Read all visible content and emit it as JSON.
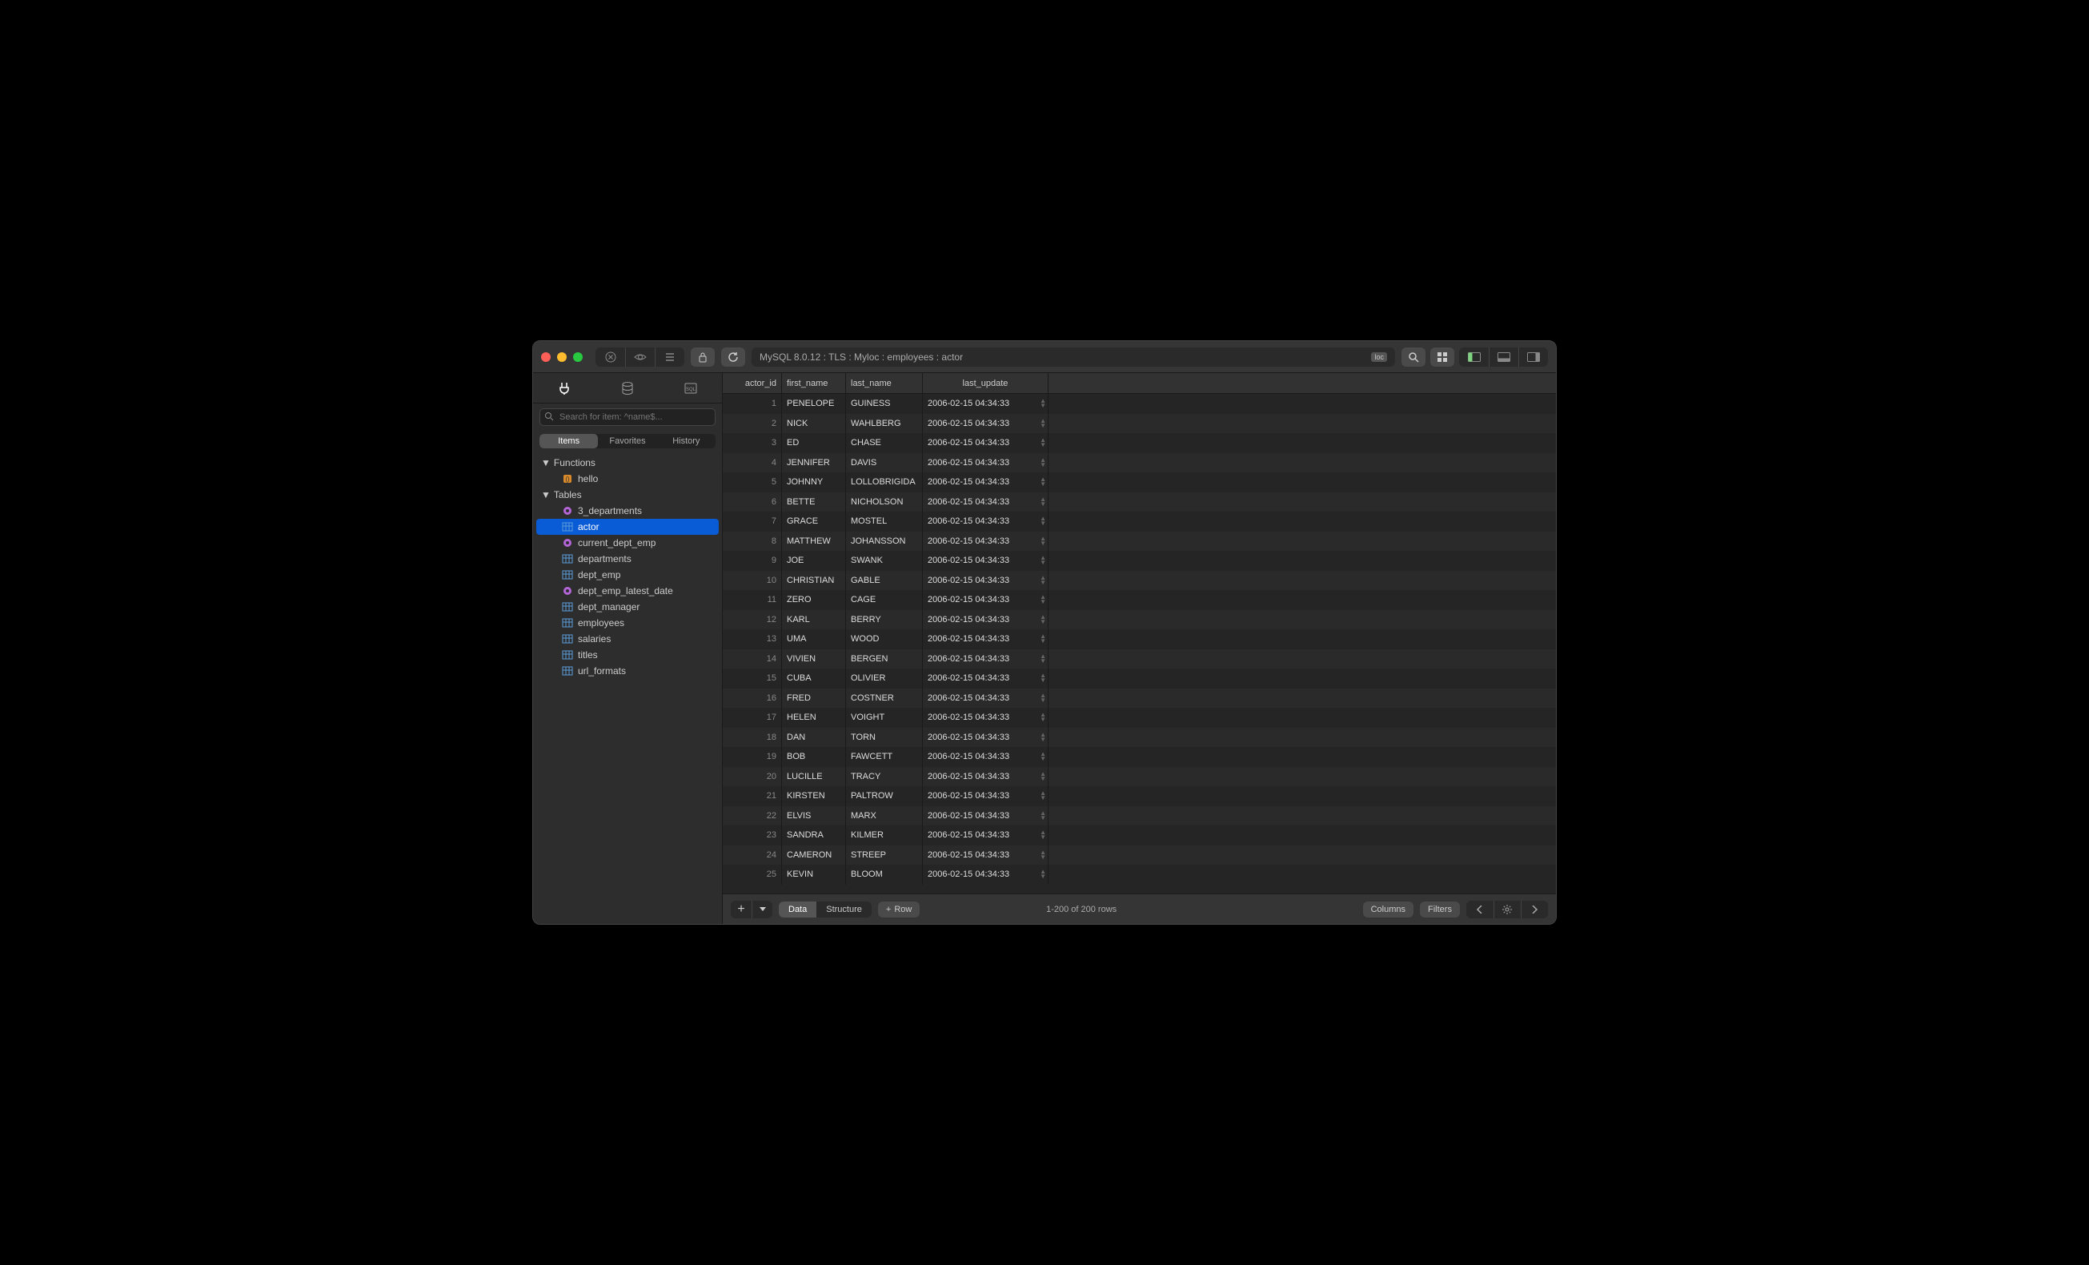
{
  "breadcrumb": "MySQL 8.0.12 : TLS : Myloc : employees : actor",
  "breadcrumb_badge": "loc",
  "search": {
    "placeholder": "Search for item: ^name$..."
  },
  "sidebar_filter": {
    "items": "Items",
    "favorites": "Favorites",
    "history": "History"
  },
  "tree": {
    "functions_label": "Functions",
    "functions": [
      {
        "name": "hello",
        "kind": "func"
      }
    ],
    "tables_label": "Tables",
    "tables": [
      {
        "name": "3_departments",
        "kind": "view"
      },
      {
        "name": "actor",
        "kind": "table",
        "selected": true
      },
      {
        "name": "current_dept_emp",
        "kind": "view"
      },
      {
        "name": "departments",
        "kind": "table"
      },
      {
        "name": "dept_emp",
        "kind": "table"
      },
      {
        "name": "dept_emp_latest_date",
        "kind": "view"
      },
      {
        "name": "dept_manager",
        "kind": "table"
      },
      {
        "name": "employees",
        "kind": "table"
      },
      {
        "name": "salaries",
        "kind": "table"
      },
      {
        "name": "titles",
        "kind": "table"
      },
      {
        "name": "url_formats",
        "kind": "table"
      }
    ]
  },
  "columns": {
    "id": "actor_id",
    "fn": "first_name",
    "ln": "last_name",
    "lu": "last_update"
  },
  "rows": [
    {
      "id": "1",
      "fn": "PENELOPE",
      "ln": "GUINESS",
      "lu": "2006-02-15 04:34:33"
    },
    {
      "id": "2",
      "fn": "NICK",
      "ln": "WAHLBERG",
      "lu": "2006-02-15 04:34:33"
    },
    {
      "id": "3",
      "fn": "ED",
      "ln": "CHASE",
      "lu": "2006-02-15 04:34:33"
    },
    {
      "id": "4",
      "fn": "JENNIFER",
      "ln": "DAVIS",
      "lu": "2006-02-15 04:34:33"
    },
    {
      "id": "5",
      "fn": "JOHNNY",
      "ln": "LOLLOBRIGIDA",
      "lu": "2006-02-15 04:34:33"
    },
    {
      "id": "6",
      "fn": "BETTE",
      "ln": "NICHOLSON",
      "lu": "2006-02-15 04:34:33"
    },
    {
      "id": "7",
      "fn": "GRACE",
      "ln": "MOSTEL",
      "lu": "2006-02-15 04:34:33"
    },
    {
      "id": "8",
      "fn": "MATTHEW",
      "ln": "JOHANSSON",
      "lu": "2006-02-15 04:34:33"
    },
    {
      "id": "9",
      "fn": "JOE",
      "ln": "SWANK",
      "lu": "2006-02-15 04:34:33"
    },
    {
      "id": "10",
      "fn": "CHRISTIAN",
      "ln": "GABLE",
      "lu": "2006-02-15 04:34:33"
    },
    {
      "id": "11",
      "fn": "ZERO",
      "ln": "CAGE",
      "lu": "2006-02-15 04:34:33"
    },
    {
      "id": "12",
      "fn": "KARL",
      "ln": "BERRY",
      "lu": "2006-02-15 04:34:33"
    },
    {
      "id": "13",
      "fn": "UMA",
      "ln": "WOOD",
      "lu": "2006-02-15 04:34:33"
    },
    {
      "id": "14",
      "fn": "VIVIEN",
      "ln": "BERGEN",
      "lu": "2006-02-15 04:34:33"
    },
    {
      "id": "15",
      "fn": "CUBA",
      "ln": "OLIVIER",
      "lu": "2006-02-15 04:34:33"
    },
    {
      "id": "16",
      "fn": "FRED",
      "ln": "COSTNER",
      "lu": "2006-02-15 04:34:33"
    },
    {
      "id": "17",
      "fn": "HELEN",
      "ln": "VOIGHT",
      "lu": "2006-02-15 04:34:33"
    },
    {
      "id": "18",
      "fn": "DAN",
      "ln": "TORN",
      "lu": "2006-02-15 04:34:33"
    },
    {
      "id": "19",
      "fn": "BOB",
      "ln": "FAWCETT",
      "lu": "2006-02-15 04:34:33"
    },
    {
      "id": "20",
      "fn": "LUCILLE",
      "ln": "TRACY",
      "lu": "2006-02-15 04:34:33"
    },
    {
      "id": "21",
      "fn": "KIRSTEN",
      "ln": "PALTROW",
      "lu": "2006-02-15 04:34:33"
    },
    {
      "id": "22",
      "fn": "ELVIS",
      "ln": "MARX",
      "lu": "2006-02-15 04:34:33"
    },
    {
      "id": "23",
      "fn": "SANDRA",
      "ln": "KILMER",
      "lu": "2006-02-15 04:34:33"
    },
    {
      "id": "24",
      "fn": "CAMERON",
      "ln": "STREEP",
      "lu": "2006-02-15 04:34:33"
    },
    {
      "id": "25",
      "fn": "KEVIN",
      "ln": "BLOOM",
      "lu": "2006-02-15 04:34:33"
    }
  ],
  "footer": {
    "data": "Data",
    "structure": "Structure",
    "row": "Row",
    "status": "1-200 of 200 rows",
    "columns": "Columns",
    "filters": "Filters"
  }
}
